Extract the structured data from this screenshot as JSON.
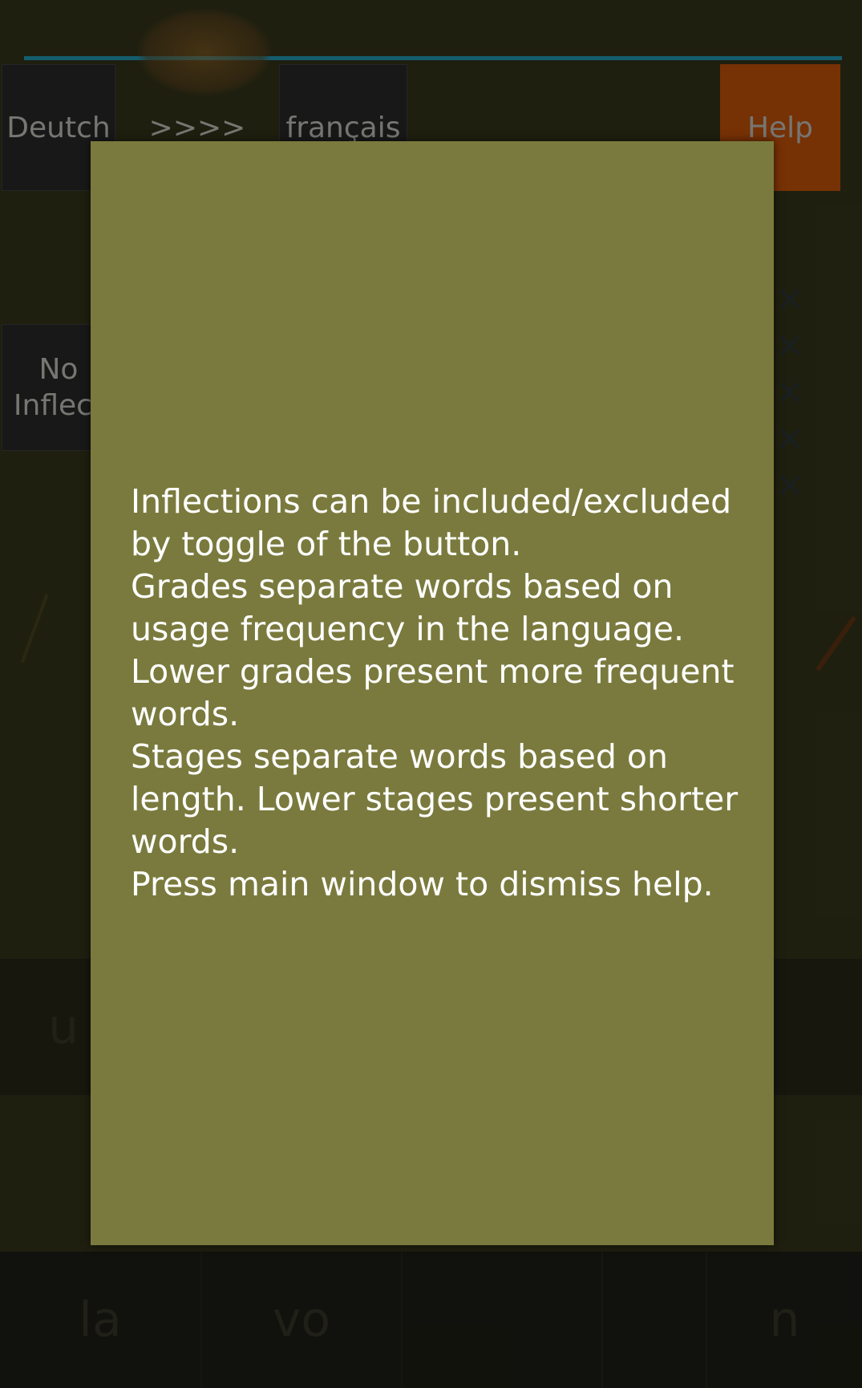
{
  "toolbar": {
    "source_language": "Deutch",
    "direction_arrow": ">>>>",
    "target_language": "français",
    "help_label": "Help"
  },
  "controls": {
    "inflection_toggle_label": "No\nInflect"
  },
  "word_tiles": [
    "la",
    "vo",
    "",
    "",
    "n"
  ],
  "mid_tile": "u",
  "help_dialog": {
    "text": "Inflections can be included/excluded by toggle of the button.\nGrades separate words based on usage frequency in the language.\nLower grades present more frequent words.\nStages separate words based on length.  Lower stages present shorter words.\nPress main window to dismiss help."
  },
  "colors": {
    "dialog_background": "#7a7a3e",
    "help_button": "#d75a0a",
    "accent_line": "#25a9c9"
  }
}
